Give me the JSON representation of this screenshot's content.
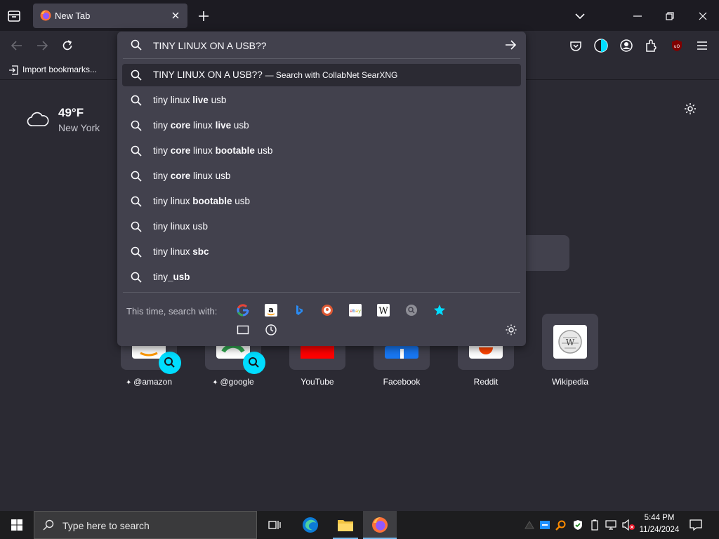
{
  "browser": {
    "tab_title": "New Tab",
    "bookmarks_import_label": "Import bookmarks..."
  },
  "weather": {
    "temperature": "49°F",
    "location": "New York"
  },
  "urlbar": {
    "value": "TINY LINUX ON A USB??",
    "heuristic": {
      "query": "TINY LINUX ON A USB??",
      "action": "— Search with CollabNet SearXNG"
    },
    "suggestions": [
      {
        "parts": [
          {
            "t": "tiny linux ",
            "b": false
          },
          {
            "t": "live",
            "b": true
          },
          {
            "t": " usb",
            "b": false
          }
        ]
      },
      {
        "parts": [
          {
            "t": "tiny ",
            "b": false
          },
          {
            "t": "core",
            "b": true
          },
          {
            "t": " linux ",
            "b": false
          },
          {
            "t": "live",
            "b": true
          },
          {
            "t": " usb",
            "b": false
          }
        ]
      },
      {
        "parts": [
          {
            "t": "tiny ",
            "b": false
          },
          {
            "t": "core",
            "b": true
          },
          {
            "t": " linux ",
            "b": false
          },
          {
            "t": "bootable",
            "b": true
          },
          {
            "t": " usb",
            "b": false
          }
        ]
      },
      {
        "parts": [
          {
            "t": "tiny ",
            "b": false
          },
          {
            "t": "core",
            "b": true
          },
          {
            "t": " linux usb",
            "b": false
          }
        ]
      },
      {
        "parts": [
          {
            "t": "tiny linux ",
            "b": false
          },
          {
            "t": "bootable",
            "b": true
          },
          {
            "t": " usb",
            "b": false
          }
        ]
      },
      {
        "parts": [
          {
            "t": "tiny linux usb",
            "b": false
          }
        ]
      },
      {
        "parts": [
          {
            "t": "tiny linux ",
            "b": false
          },
          {
            "t": "sbc",
            "b": true
          }
        ]
      },
      {
        "parts": [
          {
            "t": "tiny",
            "b": false
          },
          {
            "t": "_usb",
            "b": true
          }
        ]
      }
    ],
    "one_off_label": "This time, search with:",
    "engines": [
      "google-icon",
      "amazon-icon",
      "bing-icon",
      "duckduckgo-icon",
      "ebay-icon",
      "wikipedia-icon",
      "searxng-icon",
      "bookmarks-star-icon"
    ]
  },
  "shortcuts": [
    {
      "label": "@amazon",
      "pinned": true
    },
    {
      "label": "@google",
      "pinned": true
    },
    {
      "label": "YouTube",
      "pinned": false
    },
    {
      "label": "Facebook",
      "pinned": false
    },
    {
      "label": "Reddit",
      "pinned": false
    },
    {
      "label": "Wikipedia",
      "pinned": false
    }
  ],
  "taskbar": {
    "search_placeholder": "Type here to search",
    "time": "5:44 PM",
    "date": "11/24/2024"
  },
  "colors": {
    "accent": "#00ddff",
    "popup_bg": "#42414d",
    "page_bg": "#2b2a33"
  }
}
